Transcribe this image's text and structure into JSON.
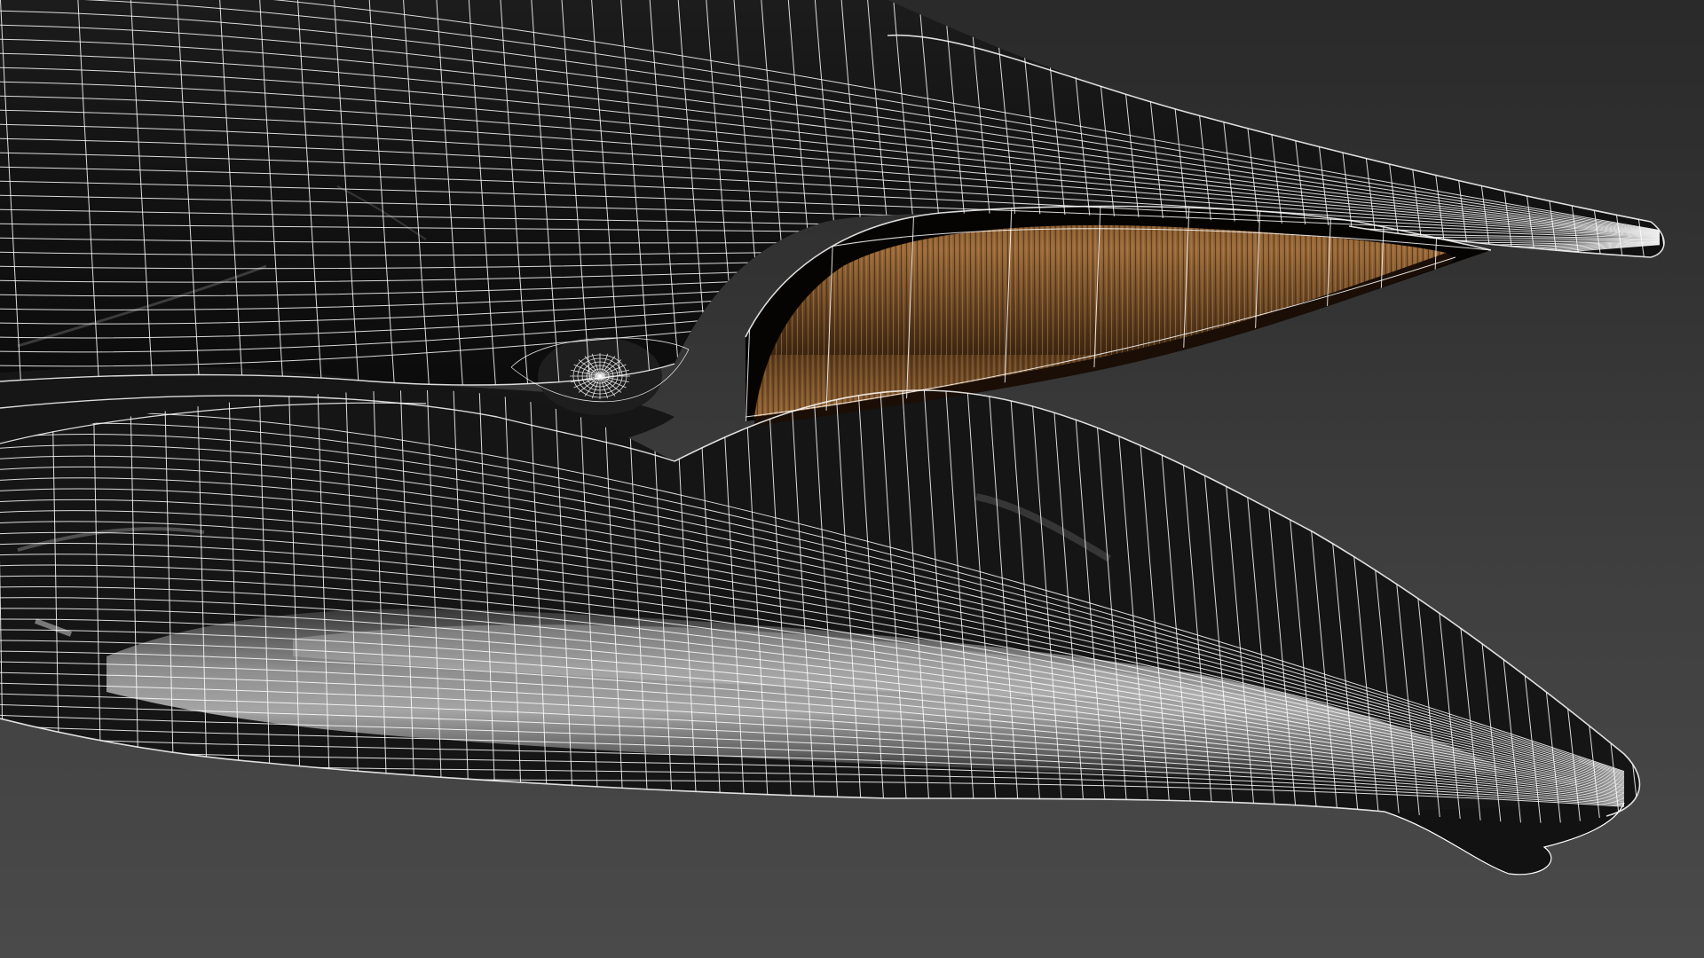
{
  "viewport": {
    "render_mode": "wireframe-on-shaded",
    "subject": "whale-head-3d-model",
    "background_color": "#454545",
    "wire_color": "#ffffff",
    "skin_color": "#141414",
    "belly_color": "#8a8a8a",
    "baleen_color": "#8b5a2b",
    "mouth_interior_color": "#050302"
  }
}
